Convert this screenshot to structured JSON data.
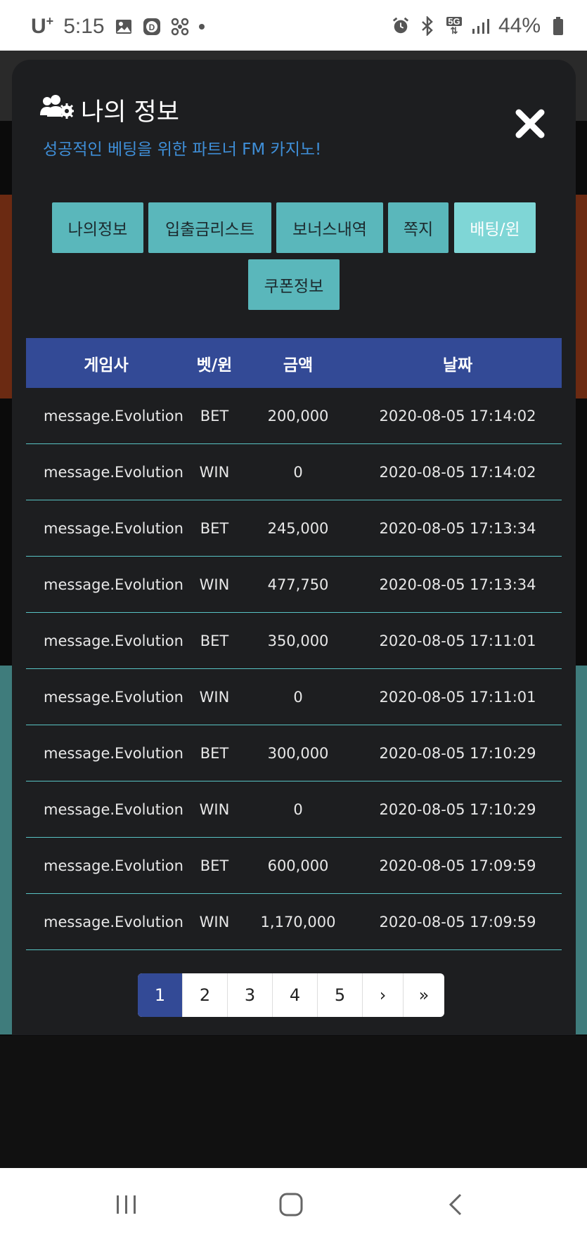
{
  "status_bar": {
    "carrier": "U",
    "carrier_sup": "+",
    "time": "5:15",
    "network": "5G",
    "battery": "44%"
  },
  "modal": {
    "title": "나의 정보",
    "subtitle": "성공적인 베팅을 위한 파트너 FM 카지노!",
    "tabs": [
      {
        "label": "나의정보"
      },
      {
        "label": "입출금리스트"
      },
      {
        "label": "보너스내역"
      },
      {
        "label": "쪽지"
      },
      {
        "label": "배팅/윈"
      },
      {
        "label": "쿠폰정보"
      }
    ],
    "active_tab": "배팅/윈",
    "table": {
      "headers": [
        "게임사",
        "벳/윈",
        "금액",
        "날짜"
      ],
      "rows": [
        [
          "message.Evolution",
          "BET",
          "200,000",
          "2020-08-05 17:14:02"
        ],
        [
          "message.Evolution",
          "WIN",
          "0",
          "2020-08-05 17:14:02"
        ],
        [
          "message.Evolution",
          "BET",
          "245,000",
          "2020-08-05 17:13:34"
        ],
        [
          "message.Evolution",
          "WIN",
          "477,750",
          "2020-08-05 17:13:34"
        ],
        [
          "message.Evolution",
          "BET",
          "350,000",
          "2020-08-05 17:11:01"
        ],
        [
          "message.Evolution",
          "WIN",
          "0",
          "2020-08-05 17:11:01"
        ],
        [
          "message.Evolution",
          "BET",
          "300,000",
          "2020-08-05 17:10:29"
        ],
        [
          "message.Evolution",
          "WIN",
          "0",
          "2020-08-05 17:10:29"
        ],
        [
          "message.Evolution",
          "BET",
          "600,000",
          "2020-08-05 17:09:59"
        ],
        [
          "message.Evolution",
          "WIN",
          "1,170,000",
          "2020-08-05 17:09:59"
        ]
      ]
    },
    "pagination": {
      "pages": [
        "1",
        "2",
        "3",
        "4",
        "5"
      ],
      "current": "1",
      "next": "›",
      "last": "»"
    }
  },
  "colors": {
    "accent_tab": "#5ab7bb",
    "active_tab": "#7fd6d6",
    "header_blue": "#334a96",
    "subtitle_blue": "#3f8fd8",
    "row_divider": "#58c4c4"
  }
}
